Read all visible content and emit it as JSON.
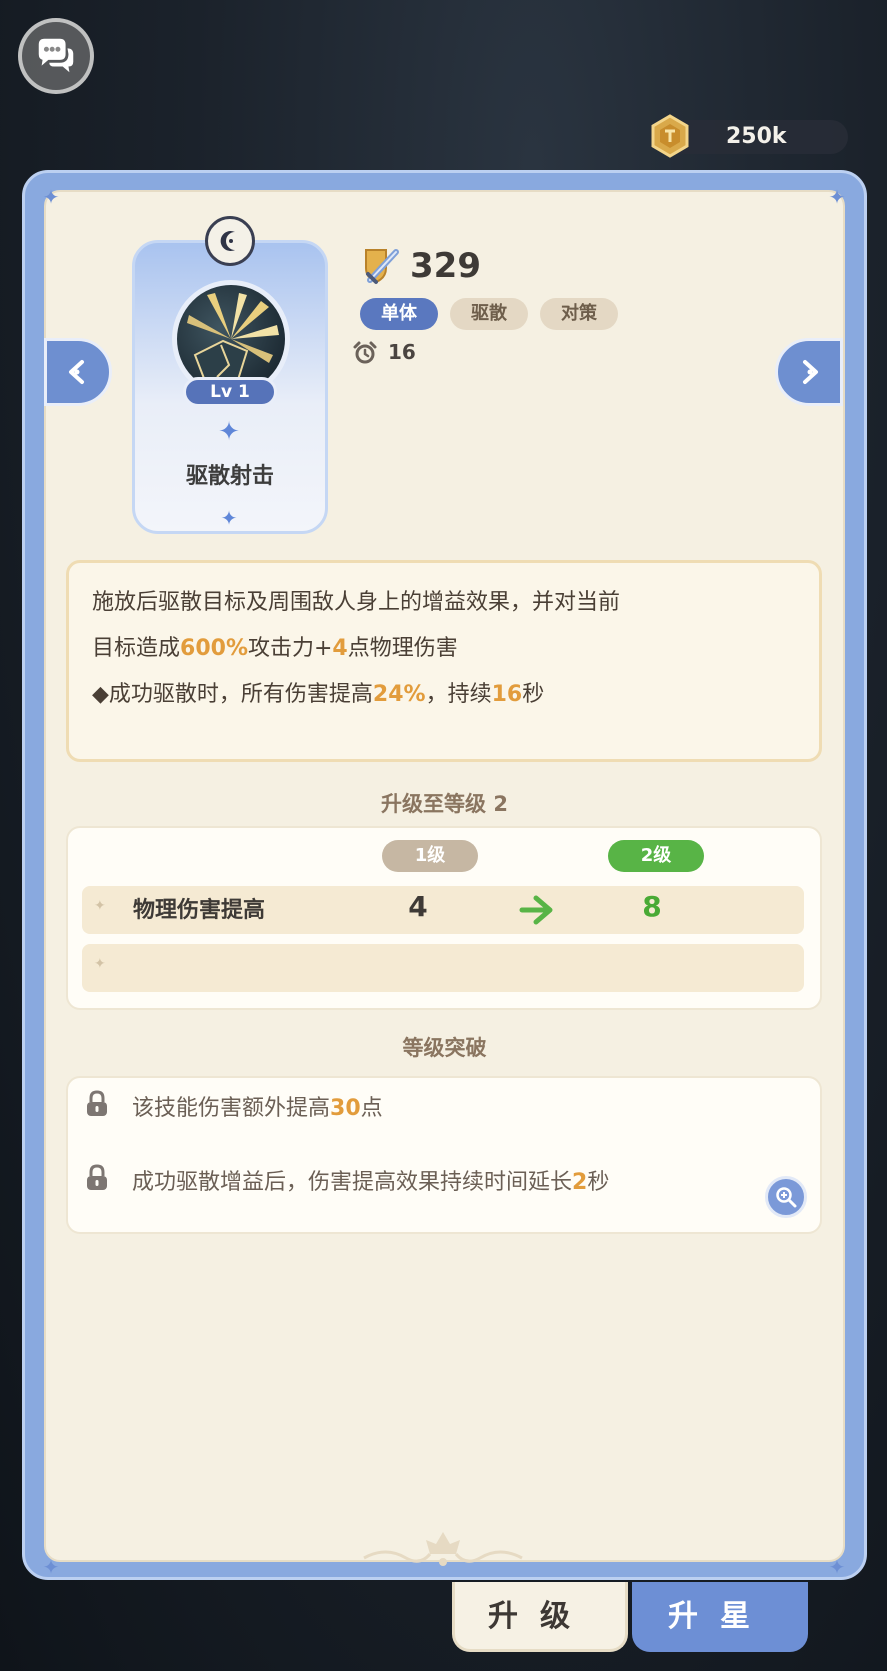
{
  "top_bar": {
    "chat_icon": "chat-bubbles-icon",
    "coin_icon": "gold-coin-icon",
    "currency_amount": "250k"
  },
  "navigation": {
    "prev_icon": "arrow-left-icon",
    "next_icon": "arrow-right-icon"
  },
  "skill": {
    "level_label": "Lv 1",
    "name": "驱散射击",
    "power_icon": "shield-sword-icon",
    "power": "329",
    "tags": [
      "单体",
      "驱散",
      "对策"
    ],
    "cooldown_icon": "alarm-clock-icon",
    "cooldown": "16"
  },
  "description": {
    "line1": "施放后驱散目标及周围敌人身上的增益效果，并对当前",
    "line2_a": "目标造成",
    "line2_b": "600%",
    "line2_c": "攻击力+",
    "line2_d": "4",
    "line2_e": "点物理伤害",
    "line3_a": "◆成功驱散时，所有伤害提高",
    "line3_b": "24%",
    "line3_c": "，持续",
    "line3_d": "16",
    "line3_e": "秒"
  },
  "upgrade": {
    "title": "升级至等级 2",
    "current_level": "1级",
    "next_level": "2级",
    "rows": [
      {
        "label": "物理伤害提高",
        "old": "4",
        "new": "8"
      }
    ]
  },
  "breakthrough": {
    "title": "等级突破",
    "items": [
      {
        "a": "该技能伤害额外提高",
        "b": "30",
        "c": "点"
      },
      {
        "a": "成功驱散增益后，伤害提高效果持续时间延长",
        "b": "2",
        "c": "秒"
      }
    ],
    "lock_icon": "lock-icon",
    "zoom_icon": "zoom-in-icon"
  },
  "tabs": {
    "upgrade": "升级",
    "star": "升星"
  },
  "colors": {
    "highlight": "#e29c3c",
    "green": "#58b446",
    "blue": "#5a78bf",
    "panel_bg": "#f5f0e2"
  }
}
